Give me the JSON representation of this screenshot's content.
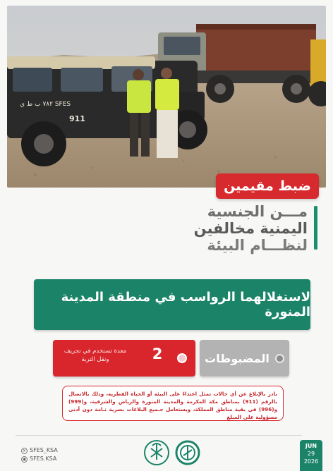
{
  "headline": {
    "tag": "ضبط مقيمين",
    "line1": "مـــن الجنسية",
    "line2": "اليمنية مخالفين",
    "line3": "لنظـــام البيئة"
  },
  "photo": {
    "vehicle_plate_text": "٧٨٢ ب ط ي SFES",
    "vehicle_door_number": "911"
  },
  "banner": {
    "text": "لاستغلالهما الرواسب في منطقة المدينة المنورة"
  },
  "stats": {
    "seized_label": "المضبوطات",
    "count": "2",
    "count_desc": "معدة تستخدم في تجريف ونقل التربة"
  },
  "notice": {
    "text": "بادر بالإبلاغ عن أي حالات تمثل اعتداءً على البيئة أو الحياة الفطرية، وذلك بالاتصال بالرقم (911) بمناطق مكة المكرمة والمدينة المنورة والرياض والشرقية، و(999) و(996) في بقية مناطق المملكة، ويستعامل جـميع البلاغات بسرية تـامة دون أدنى مسؤولية على المبلغ"
  },
  "footer": {
    "social_x": "SFES_KSA",
    "social_snap": "SFES.KSA",
    "date_month": "JUN",
    "date_day": "29",
    "date_year": "2026"
  },
  "colors": {
    "green": "#1b8468",
    "red": "#d9262c",
    "gray": "#b3b3b3"
  }
}
